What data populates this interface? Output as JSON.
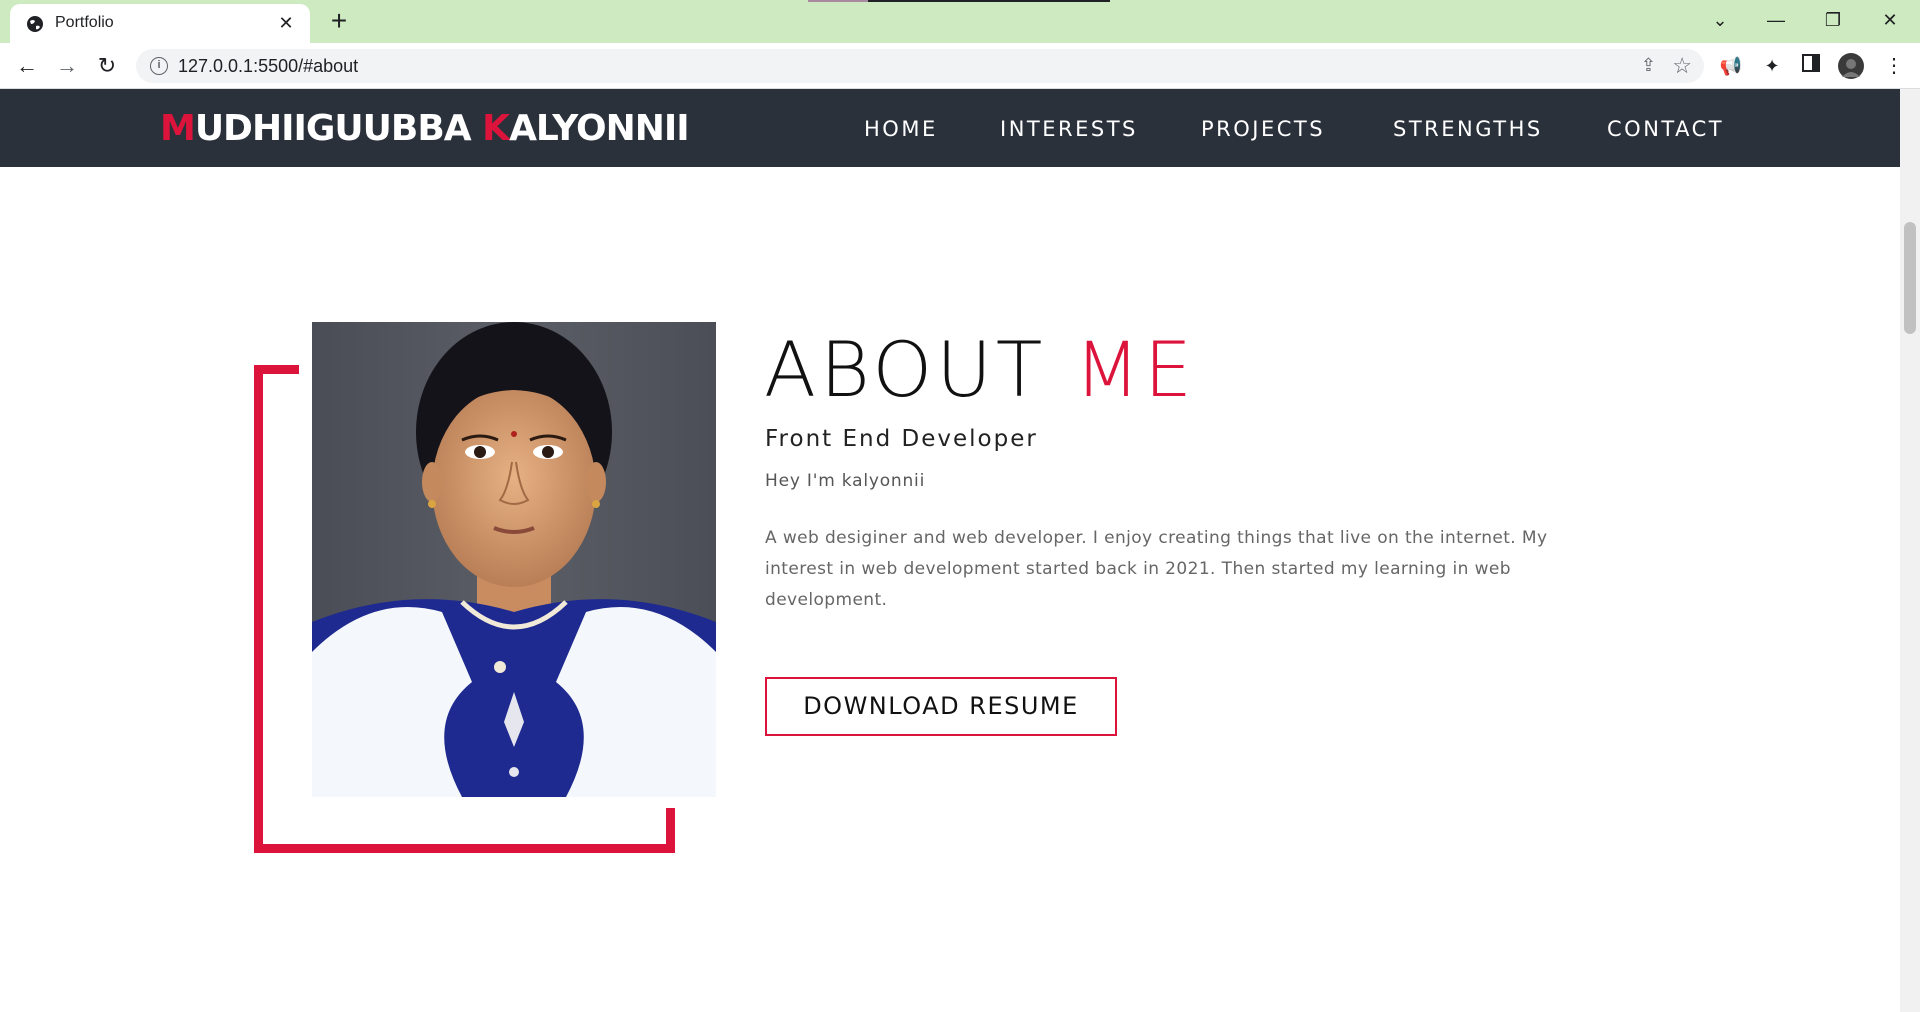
{
  "browser": {
    "tab_title": "Portfolio",
    "tab_close": "✕",
    "new_tab": "+",
    "url": "127.0.0.1:5500/#about",
    "window_controls": {
      "dropdown": "⌄",
      "minimize": "—",
      "restore": "❐",
      "close": "✕"
    },
    "nav": {
      "back": "←",
      "forward": "→",
      "reload": "↻"
    }
  },
  "site": {
    "brand": {
      "first_initial": "M",
      "first_rest": "UDHIIGUUBBA ",
      "last_initial": "K",
      "last_rest": "ALYONNII"
    },
    "menu": [
      "HOME",
      "INTERESTS",
      "PROJECTS",
      "STRENGTHS",
      "CONTACT"
    ],
    "accent_color": "#dc143c",
    "nav_background": "#2b313b"
  },
  "about": {
    "title_main": "ABOUT",
    "title_accent": "ME",
    "subtitle": "Front End Developer",
    "greeting": "Hey I'm kalyonnii",
    "description": "A web desiginer and web developer. I enjoy creating things that live on the internet. My interest in web development started back in 2021. Then started my learning in web development.",
    "button_label": "DOWNLOAD RESUME"
  }
}
